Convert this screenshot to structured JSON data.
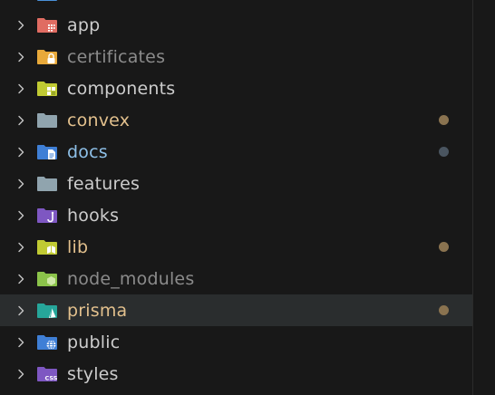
{
  "explorer": {
    "items": [
      {
        "label": "",
        "color": "#cccccc",
        "folder": "#4a90d9",
        "badge": "none",
        "dot": null,
        "selected": false
      },
      {
        "label": "app",
        "color": "#cccccc",
        "folder": "#e06c62",
        "badge": "grid",
        "dot": null,
        "selected": false
      },
      {
        "label": "certificates",
        "color": "#8b8b8b",
        "folder": "#e8a93a",
        "badge": "lock",
        "dot": null,
        "selected": false
      },
      {
        "label": "components",
        "color": "#cccccc",
        "folder": "#c0ca33",
        "badge": "blocks",
        "dot": null,
        "selected": false
      },
      {
        "label": "convex",
        "color": "#e2c08d",
        "folder": "#90a4ae",
        "badge": "none",
        "dot": "#8a7350",
        "selected": false
      },
      {
        "label": "docs",
        "color": "#8ec0e8",
        "folder": "#3f7fd6",
        "badge": "doc",
        "dot": "#4a5560",
        "selected": false
      },
      {
        "label": "features",
        "color": "#cccccc",
        "folder": "#90a4ae",
        "badge": "none",
        "dot": null,
        "selected": false
      },
      {
        "label": "hooks",
        "color": "#cccccc",
        "folder": "#7e57c2",
        "badge": "hook",
        "dot": null,
        "selected": false
      },
      {
        "label": "lib",
        "color": "#e2c08d",
        "folder": "#c0ca33",
        "badge": "book",
        "dot": "#8a7350",
        "selected": false
      },
      {
        "label": "node_modules",
        "color": "#8b8b8b",
        "folder": "#8bc34a",
        "badge": "hex",
        "dot": null,
        "selected": false
      },
      {
        "label": "prisma",
        "color": "#e2c08d",
        "folder": "#26a69a",
        "badge": "prism",
        "dot": "#8a7350",
        "selected": true
      },
      {
        "label": "public",
        "color": "#cccccc",
        "folder": "#3f7fd6",
        "badge": "globe",
        "dot": null,
        "selected": false
      },
      {
        "label": "styles",
        "color": "#cccccc",
        "folder": "#7e57c2",
        "badge": "css",
        "dot": null,
        "selected": false
      }
    ]
  }
}
